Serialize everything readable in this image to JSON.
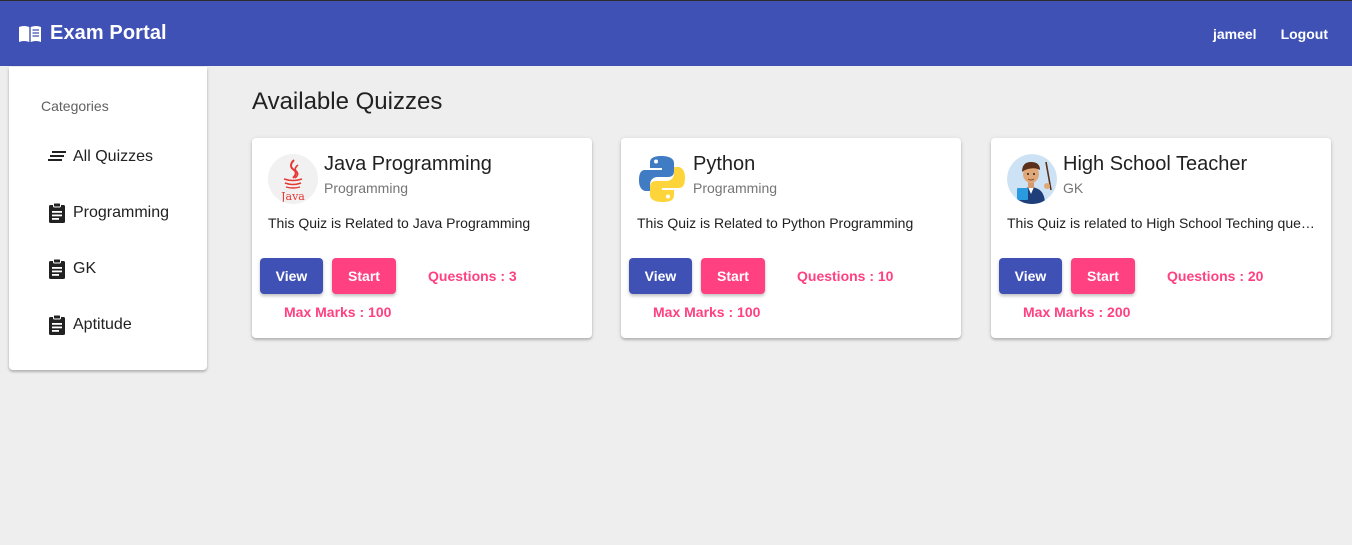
{
  "header": {
    "title": "Exam Portal",
    "brand_icon": "menu-book-icon",
    "username": "jameel",
    "logout_label": "Logout",
    "color": "#3f51b5"
  },
  "sidebar": {
    "header": "Categories",
    "items": [
      {
        "label": "All Quizzes",
        "icon": "list-icon"
      },
      {
        "label": "Programming",
        "icon": "clipboard-icon"
      },
      {
        "label": "GK",
        "icon": "clipboard-icon"
      },
      {
        "label": "Aptitude",
        "icon": "clipboard-icon"
      }
    ]
  },
  "main": {
    "title": "Available Quizzes",
    "accent_color": "#ff4081",
    "quizzes": [
      {
        "title": "Java Programming",
        "category": "Programming",
        "description": "This Quiz is Related to Java Programming",
        "view_label": "View",
        "start_label": "Start",
        "questions": "Questions : 3",
        "max_marks": "Max Marks : 100",
        "logo": "java-logo-icon",
        "logo_text": "Java"
      },
      {
        "title": "Python",
        "category": "Programming",
        "description": "This Quiz is Related to Python Programming",
        "view_label": "View",
        "start_label": "Start",
        "questions": "Questions : 10",
        "max_marks": "Max Marks : 100",
        "logo": "python-logo-icon"
      },
      {
        "title": "High School Teacher",
        "category": "GK",
        "description": "This Quiz is related to High School Teching questions",
        "view_label": "View",
        "start_label": "Start",
        "questions": "Questions : 20",
        "max_marks": "Max Marks : 200",
        "logo": "teacher-avatar-icon"
      }
    ]
  }
}
